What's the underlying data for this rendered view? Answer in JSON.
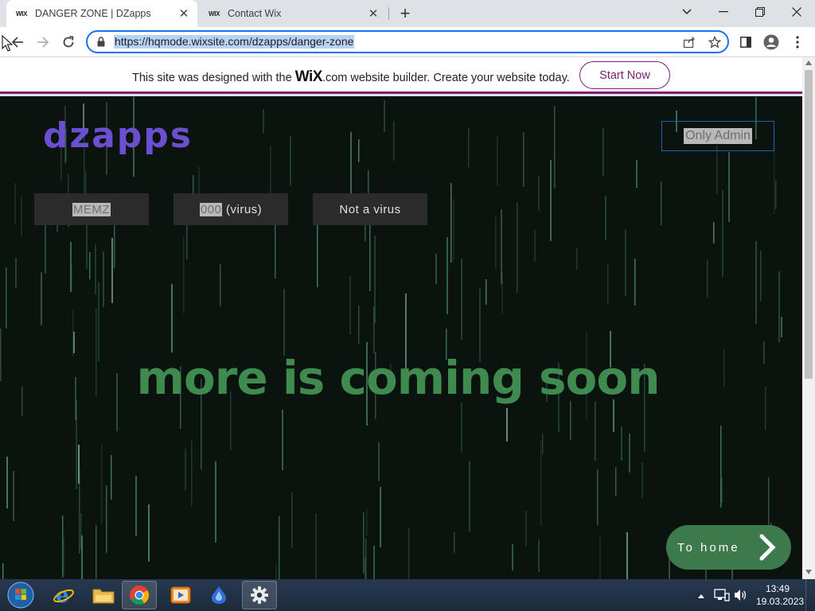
{
  "browser": {
    "tabs": [
      {
        "favicon": "WIX",
        "title": "DANGER ZONE | DZapps",
        "active": true
      },
      {
        "favicon": "WIX",
        "title": "Contact Wix",
        "active": false
      }
    ],
    "url": "https://hqmode.wixsite.com/dzapps/danger-zone"
  },
  "banner": {
    "text_before": "This site was designed with the ",
    "logo_text": "WiX",
    "text_after": ".com website builder. Create your website today.",
    "cta": "Start Now"
  },
  "site": {
    "logo": "dzapps",
    "admin_button": "Only Admin",
    "buttons": [
      {
        "highlight": "MEMZ",
        "rest": ""
      },
      {
        "highlight": "000",
        "rest": " (virus)"
      },
      {
        "highlight": "",
        "rest": "Not a virus"
      }
    ],
    "headline": "more is coming soon",
    "to_home": "To home"
  },
  "taskbar": {
    "time": "13:49",
    "date": "19.03.2023",
    "apps": [
      "start-orb",
      "internet-explorer",
      "file-explorer",
      "chrome",
      "media-player",
      "app-blue",
      "settings"
    ]
  },
  "colors": {
    "accent": "#1a73e8",
    "wix_purple": "#7b1f73",
    "page_bg": "#0b130f",
    "headline": "#3f8a4f",
    "to_home_bg": "#3c7a4c"
  }
}
